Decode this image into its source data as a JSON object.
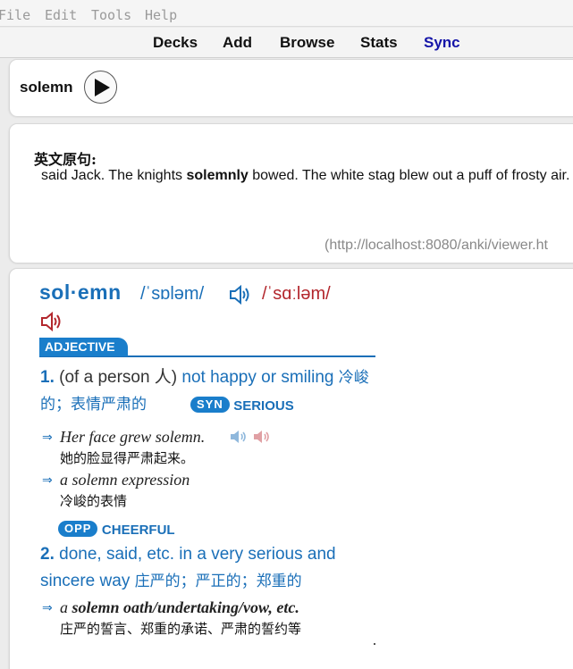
{
  "menu": [
    "File",
    "Edit",
    "Tools",
    "Help"
  ],
  "toolbar": {
    "decks": "Decks",
    "add": "Add",
    "browse": "Browse",
    "stats": "Stats",
    "sync": "Sync"
  },
  "card_front": {
    "word": "solemn"
  },
  "source": {
    "label": "英文原句:",
    "sentence_before": "said Jack. The knights ",
    "sentence_bold": "solemnly",
    "sentence_after": " bowed. The white stag blew out a puff of frosty air.",
    "url": "(http://localhost:8080/anki/viewer.ht"
  },
  "entry": {
    "headword": "sol·emn",
    "pron_uk": "/ˈsɒləm/",
    "pron_us": "/ˈsɑːləm/",
    "pos": "ADJECTIVE",
    "senses": [
      {
        "num": "1.",
        "gram": "(of a person 人)",
        "def": " not happy or smiling ",
        "zh": "冷峻的；表情严肃的",
        "syn_badge": "SYN",
        "syn_word": "SERIOUS",
        "examples": [
          {
            "en": "Her face grew solemn.",
            "cn": "她的脸显得严肃起来。"
          },
          {
            "en": "a solemn expression",
            "cn": "冷峻的表情"
          }
        ],
        "opp_badge": "OPP",
        "opp_word": "CHEERFUL"
      },
      {
        "num": "2.",
        "def": " done, said, etc. in a very serious and sincere way ",
        "zh": "庄严的；严正的；郑重的",
        "examples": [
          {
            "en_pre": "a ",
            "en_bold": "solemn oath/undertaking/vow, etc.",
            "cn": "庄严的誓言、郑重的承诺、严肃的誓约等"
          }
        ]
      }
    ]
  },
  "colors": {
    "headword_blue": "#1a6fb8",
    "us_red": "#b3272d",
    "badge_blue": "#1a7ecb",
    "sync_blue": "#1515a8"
  },
  "icons": {
    "uk_audio": "speaker-icon",
    "us_audio": "speaker-icon",
    "play": "play-icon"
  }
}
